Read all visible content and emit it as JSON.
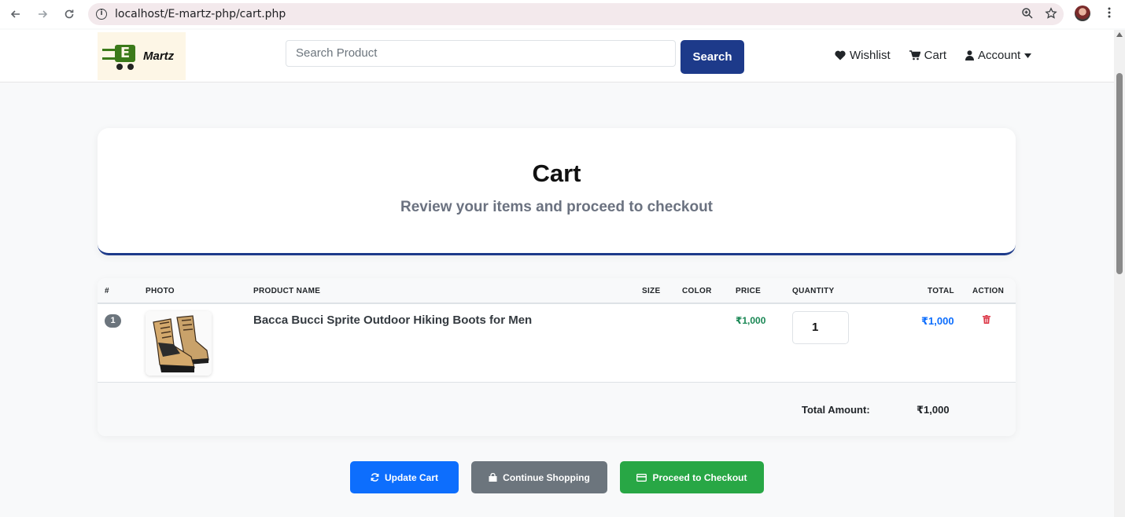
{
  "browser": {
    "url": "localhost/E-martz-php/cart.php"
  },
  "header": {
    "logo_text": "Martz",
    "search_placeholder": "Search Product",
    "search_button": "Search",
    "wishlist": "Wishlist",
    "cart": "Cart",
    "account": "Account"
  },
  "hero": {
    "title": "Cart",
    "subtitle": "Review your items and proceed to checkout"
  },
  "table": {
    "headers": {
      "index": "#",
      "photo": "PHOTO",
      "name": "PRODUCT NAME",
      "size": "SIZE",
      "color": "COLOR",
      "price": "PRICE",
      "quantity": "QUANTITY",
      "total": "TOTAL",
      "action": "ACTION"
    },
    "rows": [
      {
        "index": "1",
        "name": "Bacca Bucci Sprite Outdoor Hiking Boots for Men",
        "size": "",
        "color": "",
        "price": "₹1,000",
        "quantity": "1",
        "total": "₹1,000"
      }
    ],
    "footer": {
      "total_label": "Total Amount:",
      "total_value": "₹1,000"
    }
  },
  "actions": {
    "update": "Update Cart",
    "continue": "Continue Shopping",
    "checkout": "Proceed to Checkout"
  },
  "colors": {
    "brand_blue": "#1d3a8a",
    "price_green": "#198754",
    "total_blue": "#0d6efd",
    "delete_red": "#dc3545"
  }
}
